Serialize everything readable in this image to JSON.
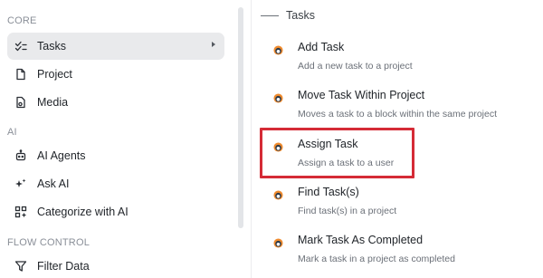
{
  "sidebar": {
    "sections": [
      {
        "label": "CORE",
        "items": [
          {
            "label": "Tasks",
            "icon": "checks-icon",
            "active": true
          },
          {
            "label": "Project",
            "icon": "document-icon"
          },
          {
            "label": "Media",
            "icon": "media-icon"
          }
        ]
      },
      {
        "label": "AI",
        "items": [
          {
            "label": "AI Agents",
            "icon": "robot-icon"
          },
          {
            "label": "Ask AI",
            "icon": "sparkles-icon"
          },
          {
            "label": "Categorize with AI",
            "icon": "grid-icon"
          }
        ]
      },
      {
        "label": "FLOW CONTROL",
        "items": [
          {
            "label": "Filter Data",
            "icon": "filter-icon"
          }
        ]
      }
    ]
  },
  "panel": {
    "title": "Tasks",
    "actions": [
      {
        "title": "Add Task",
        "description": "Add a new task to a project"
      },
      {
        "title": "Move Task Within Project",
        "description": "Moves a task to a block within the same project"
      },
      {
        "title": "Assign Task",
        "description": "Assign a task to a user",
        "highlighted": true
      },
      {
        "title": "Find Task(s)",
        "description": "Find task(s) in a project"
      },
      {
        "title": "Mark Task As Completed",
        "description": "Mark a task in a project as completed"
      }
    ]
  },
  "colors": {
    "accent_highlight": "#d52b36",
    "active_bg": "#e9eaec"
  }
}
